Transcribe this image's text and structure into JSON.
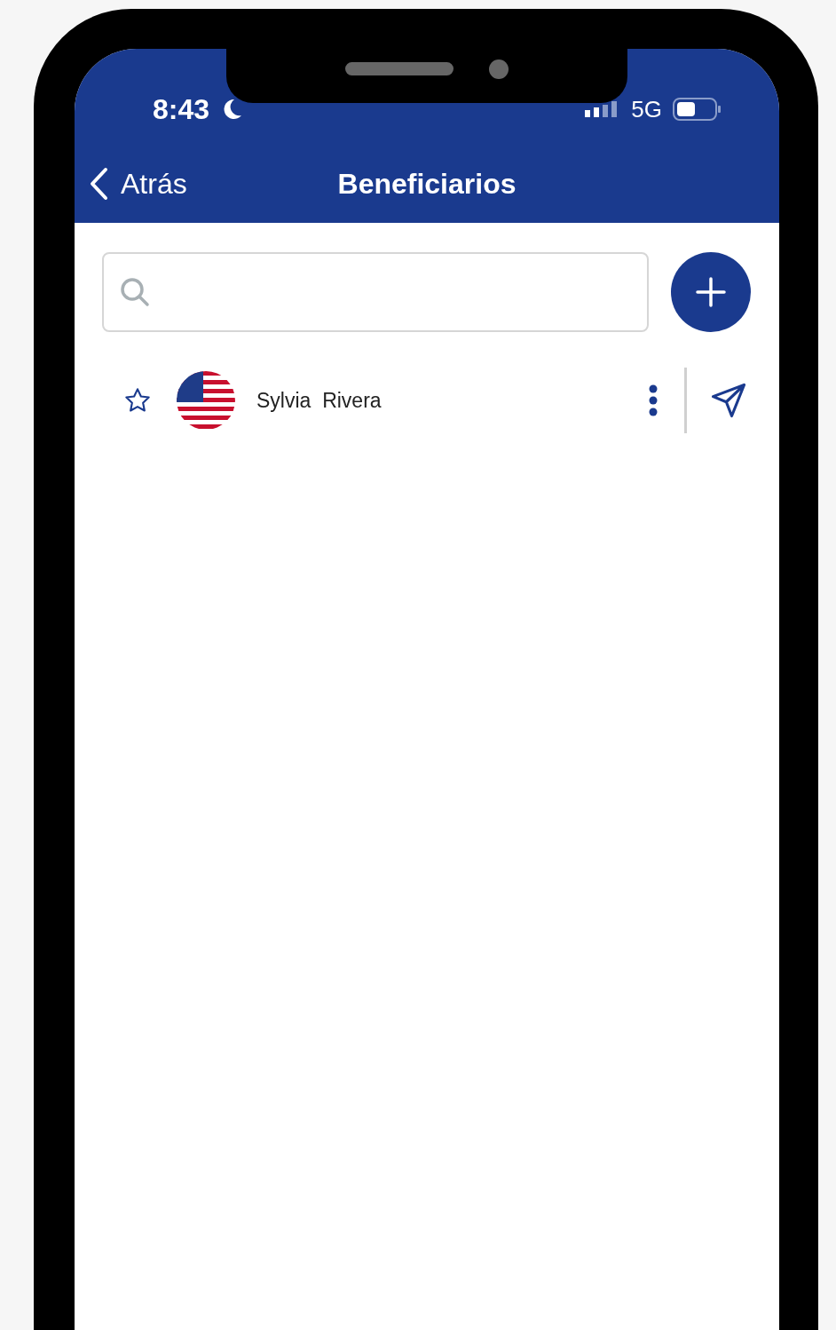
{
  "status_bar": {
    "time": "8:43",
    "network": "5G"
  },
  "nav": {
    "back": "Atrás",
    "title": "Beneficiarios"
  },
  "beneficiaries": [
    {
      "name": "Sylvia  Rivera",
      "favorite": false
    }
  ]
}
